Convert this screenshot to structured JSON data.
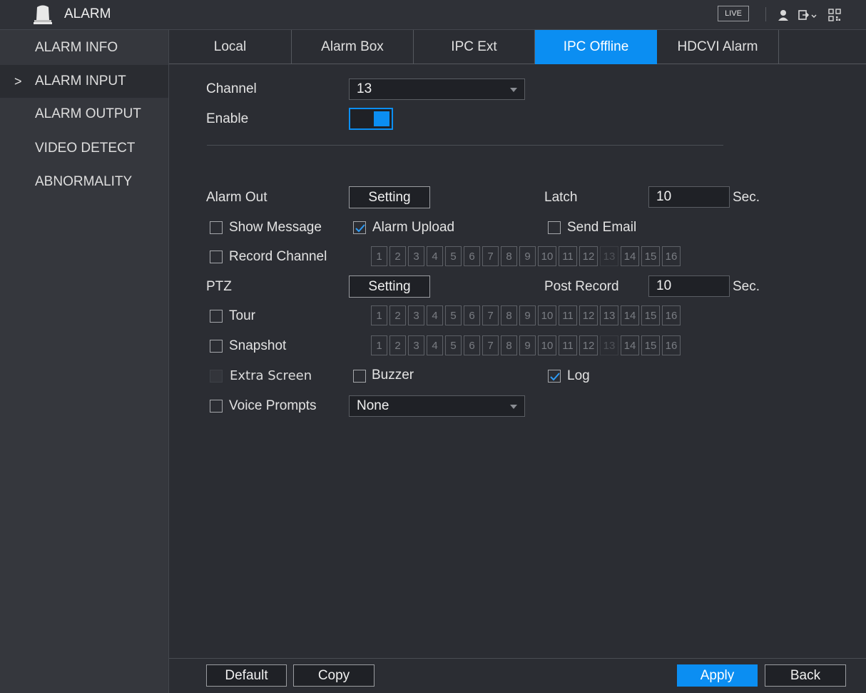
{
  "header": {
    "title": "ALARM",
    "live_label": "LIVE",
    "icons": [
      "bell-icon",
      "user-icon",
      "logout-icon",
      "qr-icon"
    ]
  },
  "sidebar": {
    "items": [
      {
        "label": "ALARM INFO",
        "active": false
      },
      {
        "label": "ALARM INPUT",
        "active": true
      },
      {
        "label": "ALARM OUTPUT",
        "active": false
      },
      {
        "label": "VIDEO DETECT",
        "active": false
      },
      {
        "label": "ABNORMALITY",
        "active": false
      }
    ],
    "chevron": ">"
  },
  "tabs": [
    {
      "label": "Local",
      "active": false
    },
    {
      "label": "Alarm Box",
      "active": false
    },
    {
      "label": "IPC Ext",
      "active": false
    },
    {
      "label": "IPC Offline",
      "active": true
    },
    {
      "label": "HDCVI Alarm",
      "active": false
    }
  ],
  "form": {
    "channel_label": "Channel",
    "channel_value": "13",
    "enable_label": "Enable",
    "enable_on": true,
    "alarm_out_label": "Alarm Out",
    "setting_label": "Setting",
    "latch_label": "Latch",
    "latch_value": "10",
    "sec_label": "Sec.",
    "show_message_label": "Show Message",
    "show_message_checked": false,
    "alarm_upload_label": "Alarm Upload",
    "alarm_upload_checked": true,
    "send_email_label": "Send Email",
    "send_email_checked": false,
    "record_channel_label": "Record Channel",
    "record_channel_checked": false,
    "ptz_label": "PTZ",
    "post_record_label": "Post Record",
    "post_record_value": "10",
    "tour_label": "Tour",
    "tour_checked": false,
    "snapshot_label": "Snapshot",
    "snapshot_checked": false,
    "extra_screen_label": "Extra Screen",
    "buzzer_label": "Buzzer",
    "buzzer_checked": false,
    "log_label": "Log",
    "log_checked": true,
    "voice_prompts_label": "Voice Prompts",
    "voice_prompts_checked": false,
    "voice_value": "None",
    "channels": [
      "1",
      "2",
      "3",
      "4",
      "5",
      "6",
      "7",
      "8",
      "9",
      "10",
      "11",
      "12",
      "13",
      "14",
      "15",
      "16"
    ]
  },
  "footer": {
    "default_label": "Default",
    "copy_label": "Copy",
    "apply_label": "Apply",
    "back_label": "Back"
  },
  "colors": {
    "accent": "#0b8ef2",
    "background": "#2b2d33",
    "sidebar": "#35373d"
  }
}
